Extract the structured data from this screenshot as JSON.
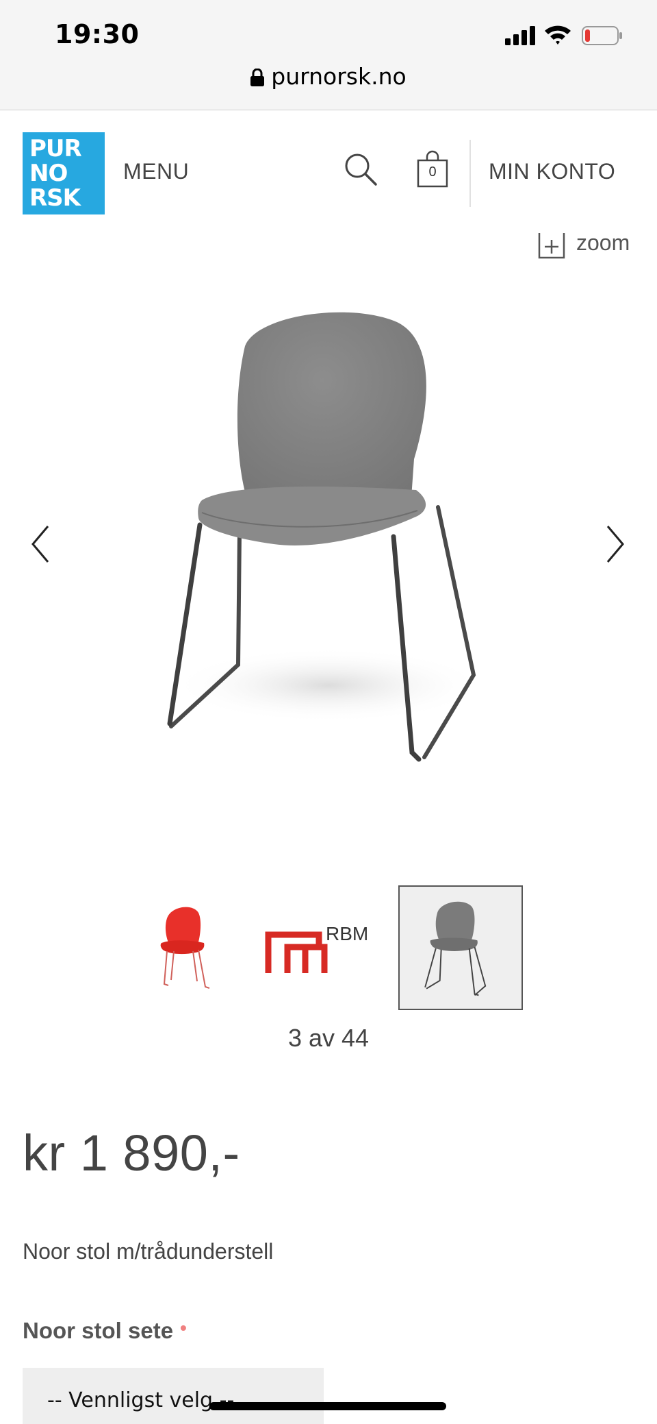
{
  "status_bar": {
    "time": "19:30",
    "signal_icon": "cellular-signal-icon",
    "wifi_icon": "wifi-icon",
    "battery_icon": "battery-low-icon",
    "battery_color": "#e53935"
  },
  "browser": {
    "url": "purnorsk.no",
    "lock_icon": "lock-icon"
  },
  "header": {
    "logo_lines": [
      "PUR",
      "NO",
      "RSK"
    ],
    "logo_color": "#27a8e0",
    "menu_label": "MENU",
    "search_icon": "search-icon",
    "cart_icon": "shopping-bag-icon",
    "cart_count": "0",
    "account_label": "MIN KONTO"
  },
  "gallery": {
    "zoom_label": "zoom",
    "counter": "3 av 44",
    "thumbnails": [
      {
        "name": "red-chair-thumbnail"
      },
      {
        "name": "rbm-logo-thumbnail",
        "text": "RBM"
      },
      {
        "name": "grey-chair-thumbnail",
        "selected": true
      }
    ]
  },
  "product": {
    "price": "kr 1 890,-",
    "name": "Noor stol m/trådunderstell",
    "option_label": "Noor stol sete",
    "required_mark": "•",
    "select_placeholder": "-- Vennligst velg --"
  }
}
